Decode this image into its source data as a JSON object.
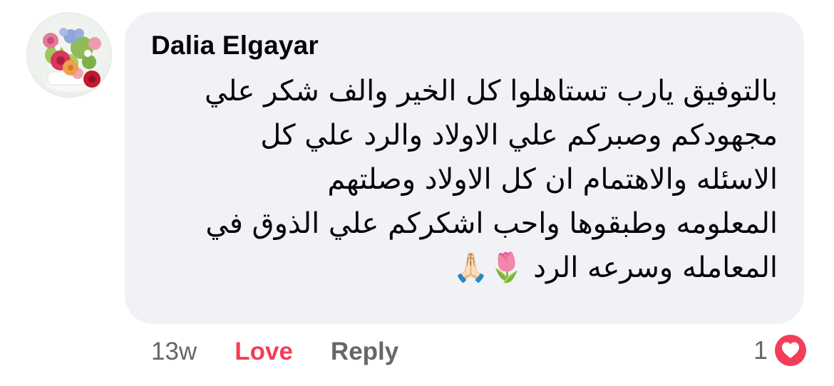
{
  "comment": {
    "author": "Dalia Elgayar",
    "text": "بالتوفيق يارب تستاهلوا كل الخير والف شكر علي\nمجهودكم وصبركم علي الاولاد والرد علي كل\nالاسئله  والاهتمام ان كل الاولاد وصلتهم\nالمعلومه وطبقوها واحب اشكركم علي الذوق في\nالمعامله وسرعه الرد 🌷🙏🏻",
    "avatar_icon": "flower-bouquet-avatar"
  },
  "actions": {
    "time": "13w",
    "love_label": "Love",
    "reply_label": "Reply"
  },
  "reactions": {
    "count": "1",
    "icon": "heart-icon"
  },
  "colors": {
    "bubble": "#f0f2f5",
    "love": "#f33e58",
    "muted": "#65676b",
    "heart_badge": "#f33e58"
  }
}
